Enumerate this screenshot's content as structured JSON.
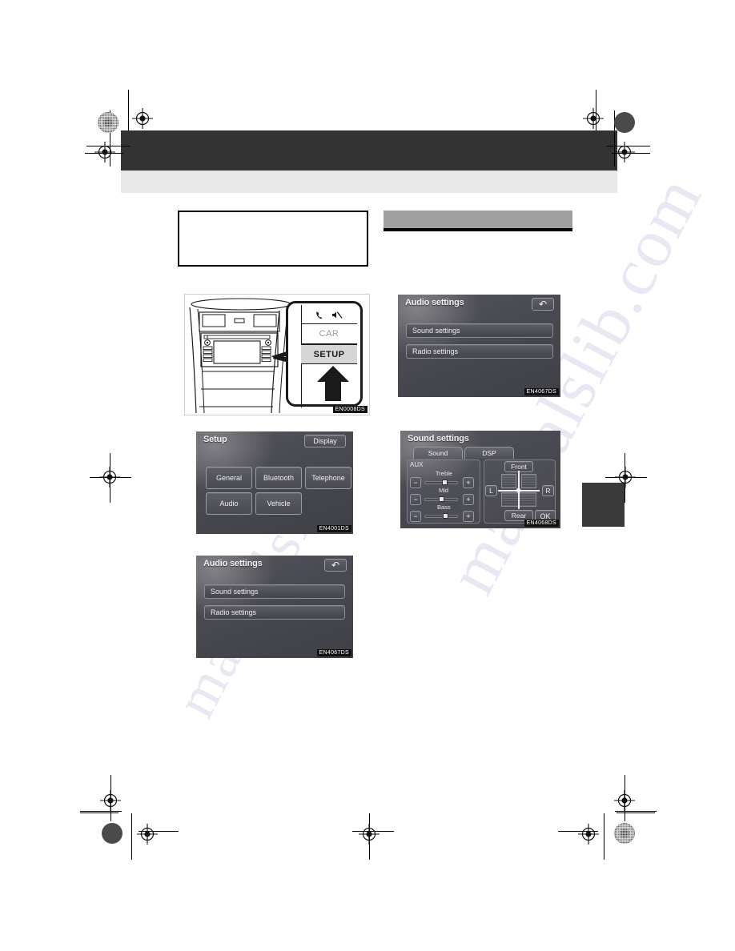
{
  "document": {
    "page_background": "#ffffff",
    "header_bar_color": "#333333",
    "header_strip_color": "#e8e8e8",
    "thumb_tab_color": "#3a3a3a",
    "section_heading_color": "#a0a0a0",
    "header_title": "",
    "section_heading_text": "",
    "note_box_text": ""
  },
  "watermarks": [
    {
      "text": "manualslib.com"
    },
    {
      "text": "manualslib"
    }
  ],
  "illustration": {
    "name": "dashboard-setup-button",
    "figure_code": "EN0008DS",
    "callout": {
      "phone_icon": "phone-icon",
      "mute_icon": "mute-icon",
      "buttons": [
        {
          "label": "CAR",
          "state": "normal"
        },
        {
          "label": "SETUP",
          "state": "highlighted"
        }
      ],
      "pointer": "up-arrow"
    }
  },
  "screens": [
    {
      "id": "audio-settings-top",
      "title": "Audio settings",
      "figure_code": "EN4067DS",
      "back_icon": "back-arrow-icon",
      "items": [
        {
          "label": "Sound settings"
        },
        {
          "label": "Radio settings"
        }
      ]
    },
    {
      "id": "sound-settings",
      "title": "Sound settings",
      "figure_code": "EN4068DS",
      "tabs": [
        {
          "label": "Sound",
          "selected": true
        },
        {
          "label": "DSP",
          "selected": false
        }
      ],
      "source_label": "AUX",
      "sliders": [
        {
          "label": "Treble",
          "minus": "−",
          "plus": "+",
          "value": 55
        },
        {
          "label": "Mid",
          "minus": "−",
          "plus": "+",
          "value": 50
        },
        {
          "label": "Bass",
          "minus": "−",
          "plus": "+",
          "value": 58
        }
      ],
      "fader": {
        "front": "Front",
        "rear": "Rear",
        "left": "L",
        "right": "R"
      },
      "ok_label": "OK"
    },
    {
      "id": "setup",
      "title": "Setup",
      "figure_code": "EN4001DS",
      "display_label": "Display",
      "buttons": [
        {
          "label": "General"
        },
        {
          "label": "Bluetooth"
        },
        {
          "label": "Telephone"
        },
        {
          "label": "Audio"
        },
        {
          "label": "Vehicle"
        }
      ]
    },
    {
      "id": "audio-settings-bottom",
      "title": "Audio settings",
      "figure_code": "EN4067DS",
      "back_icon": "back-arrow-icon",
      "items": [
        {
          "label": "Sound settings"
        },
        {
          "label": "Radio settings"
        }
      ]
    }
  ]
}
